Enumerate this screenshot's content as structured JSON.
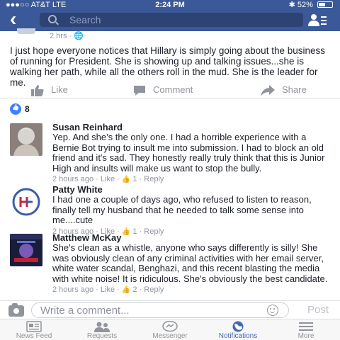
{
  "status_bar": {
    "carrier": "●●●○○ AT&T  LTE",
    "time": "2:24 PM",
    "bluetooth": "✱",
    "battery": "52%"
  },
  "header": {
    "back_icon": "back-chevron",
    "search_placeholder": "Search",
    "people_icon": "friend-requests-icon"
  },
  "post": {
    "meta": "2 hrs · 🌐",
    "text": "I just hope everyone notices that Hillary is simply going about the business of running for President. She is showing up and talking issues...she is walking her path, while all the others roll in the mud. She is the leader for me.",
    "actions": {
      "like": "Like",
      "comment": "Comment",
      "share": "Share"
    },
    "like_count": "8"
  },
  "comments": [
    {
      "name": "Susan Reinhard",
      "text": "Yep. And she's the only one. I had a horrible experience with a Bernie Bot trying to insult me into submission. I had to block an old friend and it's sad. They honestly really truly think that this is Junior High and insults will make us want to stop the bully.",
      "time": "2 hours ago",
      "like_label": "Like",
      "likes": "1",
      "reply_label": "Reply"
    },
    {
      "name": "Patty White",
      "text": "I had one a couple of days ago, who refused to listen to reason, finally tell my husband that he needed to talk some sense into me....cute",
      "time": "2 hours ago",
      "like_label": "Like",
      "likes": "1",
      "reply_label": "Reply"
    },
    {
      "name": "Matthew McKay",
      "text": "She's clean as a whistle, anyone who says differently is silly! She was obviously clean of any criminal activities with her email server, white water scandal, Benghazi, and this recent blasting the media with white noise! It is ridiculous. She's obviously the best candidate.",
      "time": "2 hours ago",
      "like_label": "Like",
      "likes": "2",
      "reply_label": "Reply"
    }
  ],
  "composer": {
    "placeholder": "Write a comment...",
    "post_label": "Post"
  },
  "tabbar": [
    {
      "label": "News Feed",
      "icon": "news-feed-icon",
      "active": false
    },
    {
      "label": "Requests",
      "icon": "requests-icon",
      "active": false
    },
    {
      "label": "Messenger",
      "icon": "messenger-icon",
      "active": false
    },
    {
      "label": "Notifications",
      "icon": "globe-icon",
      "active": true
    },
    {
      "label": "More",
      "icon": "hamburger-icon",
      "active": false
    }
  ],
  "colors": {
    "brand": "#3b5998",
    "link_blue": "#4267b2",
    "like_blue": "#4080ff",
    "muted": "#90949c"
  }
}
